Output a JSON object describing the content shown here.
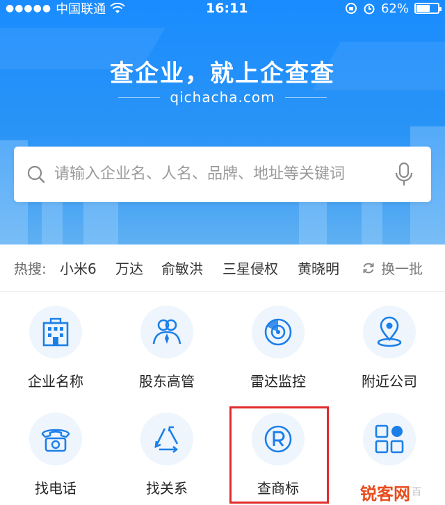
{
  "status_bar": {
    "signal": "●●●●●",
    "carrier": "中国联通",
    "time": "16:11",
    "battery": "62%",
    "battery_level": 0.62
  },
  "hero": {
    "slogan": "查企业，就上企查查",
    "domain": "qichacha.com"
  },
  "search": {
    "placeholder": "请输入企业名、人名、品牌、地址等关键词"
  },
  "hot_search": {
    "label": "热搜:",
    "items": [
      "小米6",
      "万达",
      "俞敏洪",
      "三星侵权",
      "黄晓明"
    ],
    "refresh_label": "换一批"
  },
  "grid": [
    {
      "label": "企业名称",
      "icon": "building-icon"
    },
    {
      "label": "股东高管",
      "icon": "people-icon"
    },
    {
      "label": "雷达监控",
      "icon": "radar-icon"
    },
    {
      "label": "附近公司",
      "icon": "location-icon"
    },
    {
      "label": "找电话",
      "icon": "telephone-icon"
    },
    {
      "label": "找关系",
      "icon": "relation-triangle-icon"
    },
    {
      "label": "查商标",
      "icon": "trademark-icon"
    },
    {
      "label": "",
      "icon": "more-grid-icon"
    }
  ],
  "watermark": {
    "text": "锐客网",
    "faint": "百"
  },
  "colors": {
    "brand_blue": "#1a8cff",
    "icon_blue": "#1b7fe8",
    "highlight_red": "#e12b2b"
  }
}
